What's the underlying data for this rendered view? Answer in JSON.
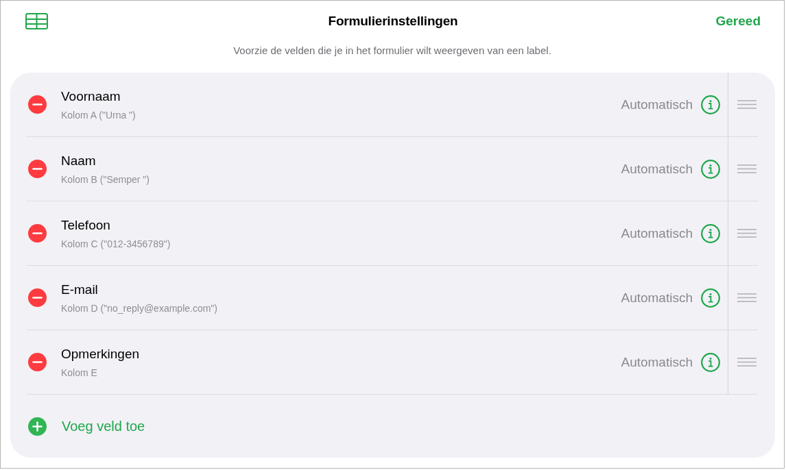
{
  "toolbar": {
    "title": "Formulierinstellingen",
    "done_button": "Gereed"
  },
  "instruction": "Voorzie de velden die je in het formulier wilt weergeven van een label.",
  "fields": [
    {
      "label": "Voornaam",
      "column": "Kolom A (\"Urna \")",
      "type": "Automatisch"
    },
    {
      "label": "Naam",
      "column": "Kolom B (\"Semper \")",
      "type": "Automatisch"
    },
    {
      "label": "Telefoon",
      "column": "Kolom C (\"012-3456789\")",
      "type": "Automatisch"
    },
    {
      "label": "E-mail",
      "column": "Kolom D (\"no_reply@example.com\")",
      "type": "Automatisch"
    },
    {
      "label": "Opmerkingen",
      "column": "Kolom E",
      "type": "Automatisch"
    }
  ],
  "add_field": "Voeg veld toe"
}
